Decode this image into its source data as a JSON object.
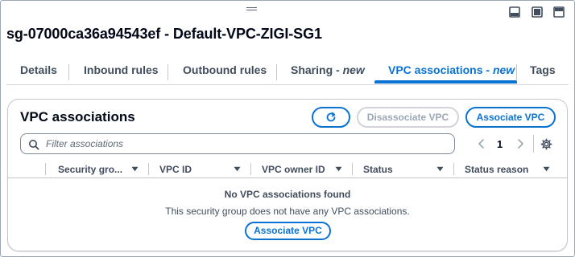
{
  "window": {
    "title": "sg-07000ca36a94543ef - Default-VPC-ZIGI-SG1"
  },
  "tabs": [
    {
      "label": "Details",
      "suffix": ""
    },
    {
      "label": "Inbound rules",
      "suffix": ""
    },
    {
      "label": "Outbound rules",
      "suffix": ""
    },
    {
      "label": "Sharing - ",
      "suffix": "new"
    },
    {
      "label": "VPC associations - ",
      "suffix": "new",
      "active": true
    },
    {
      "label": "Tags",
      "suffix": ""
    }
  ],
  "panel": {
    "title": "VPC associations",
    "refresh_icon": "refresh-icon",
    "disassociate_label": "Disassociate VPC",
    "associate_label": "Associate VPC"
  },
  "search": {
    "placeholder": "Filter associations",
    "value": ""
  },
  "pagination": {
    "current_page": "1"
  },
  "table": {
    "columns": [
      "Security gro...",
      "VPC ID",
      "VPC owner ID",
      "Status",
      "Status reason"
    ],
    "rows": []
  },
  "empty_state": {
    "title": "No VPC associations found",
    "description": "This security group does not have any VPC associations.",
    "button_label": "Associate VPC"
  },
  "colors": {
    "accent": "#0972d3",
    "text": "#000716",
    "secondary_text": "#414d5c",
    "disabled": "#9ba7b6",
    "border": "#c6c6cd"
  }
}
